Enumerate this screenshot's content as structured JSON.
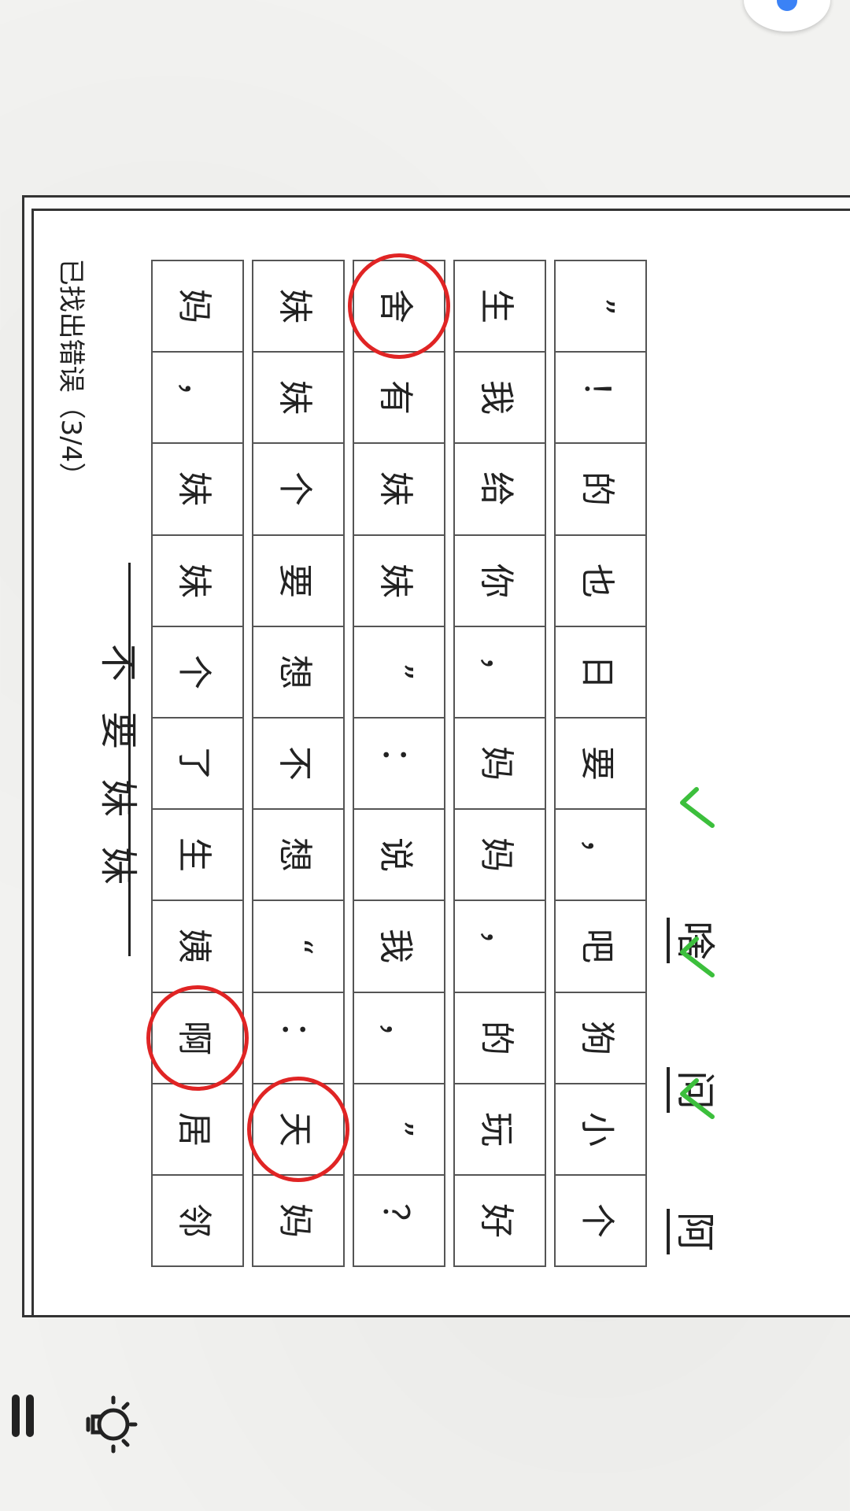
{
  "status": {
    "text": "已找出错误（3/4）"
  },
  "title": {
    "text": "不要妹妹"
  },
  "grid": {
    "columns": [
      [
        "妈",
        "，",
        "妹",
        "妹",
        "个",
        "了",
        "生",
        "姨",
        "啊",
        "居",
        "邻"
      ],
      [
        "妹",
        "妹",
        "个",
        "要",
        "想",
        "不",
        "想",
        "“",
        "：",
        "天",
        "妈"
      ],
      [
        "舍",
        "有",
        "妹",
        "妹",
        "”",
        "：",
        "说",
        "我",
        "，",
        "”",
        "？"
      ],
      [
        "生",
        "我",
        "给",
        "你",
        "，",
        "妈",
        "妈",
        "，",
        "的",
        "玩",
        "好"
      ],
      [
        "”",
        "！",
        "的",
        "也",
        "日",
        "要",
        "，",
        "吧",
        "狗",
        "小",
        "个"
      ]
    ],
    "circled": [
      "0-8",
      "1-9",
      "2-0"
    ]
  },
  "answers": [
    {
      "char": "啥",
      "correct": true
    },
    {
      "char": "问",
      "correct": true
    },
    {
      "char": "阿",
      "correct": true
    }
  ],
  "icons": {
    "menu": "menu-icon",
    "hint": "lightbulb-icon",
    "check": "check-icon"
  },
  "colors": {
    "circle": "#e02424",
    "check": "#3cbf3c",
    "ink": "#222222"
  }
}
